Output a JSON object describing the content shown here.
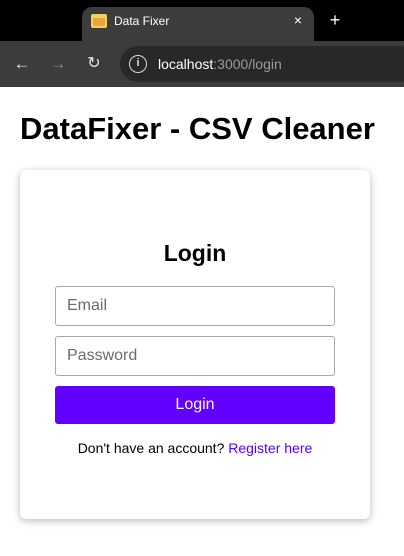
{
  "browser": {
    "tab_title": "Data Fixer",
    "tab_close": "×",
    "new_tab": "+",
    "nav_back": "←",
    "nav_forward": "→",
    "nav_reload": "↻",
    "site_info": "i",
    "url_host": "localhost",
    "url_path": ":3000/login",
    "favicon": "folder-icon"
  },
  "page": {
    "title": "DataFixer - CSV Cleaner"
  },
  "login": {
    "heading": "Login",
    "email_placeholder": "Email",
    "email_value": "",
    "password_placeholder": "Password",
    "password_value": "",
    "submit_label": "Login",
    "register_prompt": "Don't have an account? ",
    "register_link": "Register here"
  },
  "colors": {
    "accent": "#6200ff",
    "link": "#5a00f5"
  }
}
